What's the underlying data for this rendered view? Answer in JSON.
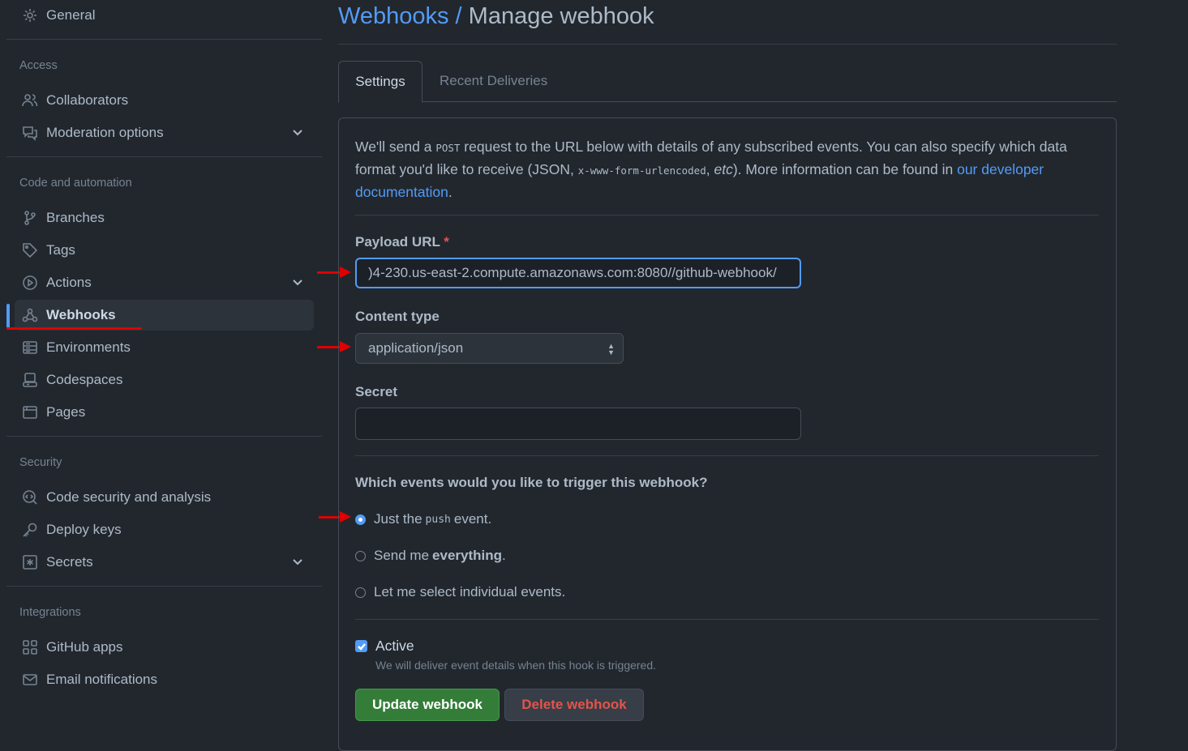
{
  "sidebar": {
    "general": "General",
    "sections": {
      "access": "Access",
      "code": "Code and automation",
      "security": "Security",
      "integrations": "Integrations"
    },
    "items": {
      "collaborators": "Collaborators",
      "moderation": "Moderation options",
      "branches": "Branches",
      "tags": "Tags",
      "actions": "Actions",
      "webhooks": "Webhooks",
      "environments": "Environments",
      "codespaces": "Codespaces",
      "pages": "Pages",
      "code_security": "Code security and analysis",
      "deploy_keys": "Deploy keys",
      "secrets": "Secrets",
      "github_apps": "GitHub apps",
      "email": "Email notifications"
    }
  },
  "header": {
    "crumb": "Webhooks",
    "sep": " / ",
    "title": "Manage webhook"
  },
  "tabs": {
    "settings": "Settings",
    "deliveries": "Recent Deliveries"
  },
  "intro": {
    "p1": "We'll send a ",
    "post": "POST",
    "p2": " request to the URL below with details of any subscribed events. You can also specify which data format you'd like to receive (JSON, ",
    "code": "x-www-form-urlencoded",
    "p3": ", ",
    "etc": "etc",
    "p4": "). More information can be found in ",
    "link": "our developer documentation",
    "p5": "."
  },
  "form": {
    "payload_label": "Payload URL",
    "required_mark": "*",
    "payload_value": ")4-230.us-east-2.compute.amazonaws.com:8080//github-webhook/",
    "content_type_label": "Content type",
    "content_type_value": "application/json",
    "secret_label": "Secret",
    "secret_value": "",
    "events_question": "Which events would you like to trigger this webhook?",
    "radio1_a": "Just the",
    "radio1_code": "push",
    "radio1_b": "event.",
    "radio2_a": "Send me",
    "radio2_b": "everything",
    "radio2_c": ".",
    "radio3": "Let me select individual events.",
    "active_label": "Active",
    "active_note": "We will deliver event details when this hook is triggered.",
    "update_button": "Update webhook",
    "delete_button": "Delete webhook"
  },
  "colors": {
    "accent": "#539bf5",
    "annotation_red": "#e00000",
    "primary_button": "#347d39",
    "danger_text": "#e5534b"
  }
}
